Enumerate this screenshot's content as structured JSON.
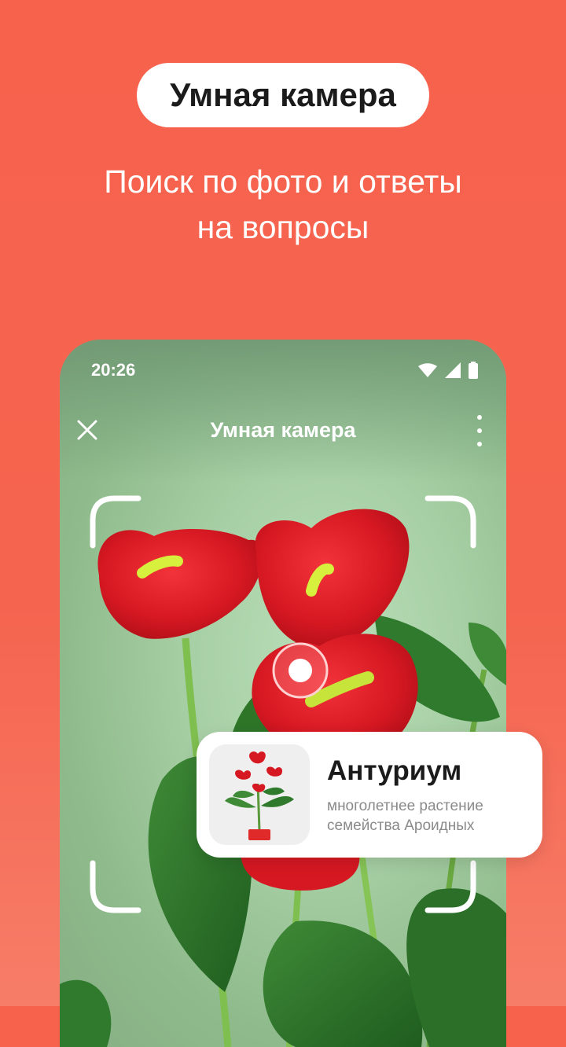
{
  "promo": {
    "title": "Умная камера",
    "subtitle_line1": "Поиск по фото и ответы",
    "subtitle_line2": "на вопросы"
  },
  "status_bar": {
    "time": "20:26",
    "icons": [
      "wifi-icon",
      "signal-icon",
      "battery-icon"
    ]
  },
  "header": {
    "title": "Умная камера",
    "close_icon": "close-icon",
    "menu_icon": "more-vertical-icon"
  },
  "result": {
    "name": "Антуриум",
    "description_line1": "многолетнее растение",
    "description_line2": "семейства Ароидных"
  },
  "colors": {
    "background": "#f7624d",
    "card": "#ffffff",
    "accent_focus": "#ff6b6b"
  }
}
